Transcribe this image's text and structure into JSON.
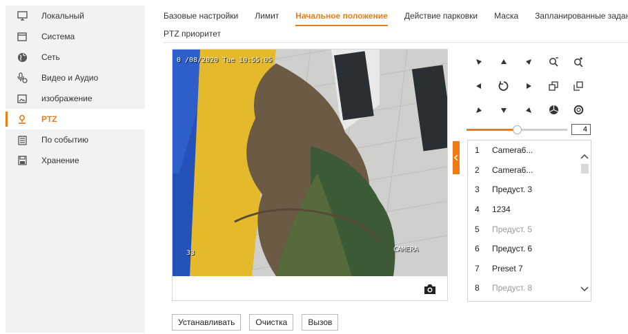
{
  "sidebar": {
    "items": [
      {
        "label": "Локальный",
        "icon": "monitor-icon"
      },
      {
        "label": "Система",
        "icon": "window-icon"
      },
      {
        "label": "Сеть",
        "icon": "globe-icon"
      },
      {
        "label": "Видео и Аудио",
        "icon": "microphone-icon"
      },
      {
        "label": "изображение",
        "icon": "image-icon"
      },
      {
        "label": "PTZ",
        "icon": "user-ptz-icon",
        "active": true
      },
      {
        "label": "По событию",
        "icon": "list-icon"
      },
      {
        "label": "Хранение",
        "icon": "storage-icon"
      }
    ]
  },
  "tabs": [
    {
      "label": "Базовые настройки"
    },
    {
      "label": "Лимит"
    },
    {
      "label": "Начальное положение",
      "active": true
    },
    {
      "label": "Действие парковки"
    },
    {
      "label": "Маска"
    },
    {
      "label": "Запланированные задания"
    },
    {
      "label": "PTZ приоритет"
    }
  ],
  "video": {
    "timestamp": "0 /08/2020 Tue 10:55:05",
    "channel_label": "33",
    "camera_label": "CAMERA"
  },
  "ptz": {
    "speed": "4",
    "speed_level": 0.5,
    "accent_color": "#f07b13"
  },
  "presets": [
    {
      "num": "1",
      "name": "Camera6...",
      "dim": false
    },
    {
      "num": "2",
      "name": "Camera6...",
      "dim": false
    },
    {
      "num": "3",
      "name": "Предуст. 3",
      "dim": false
    },
    {
      "num": "4",
      "name": "1234",
      "dim": false
    },
    {
      "num": "5",
      "name": "Предуст. 5",
      "dim": true
    },
    {
      "num": "6",
      "name": "Предуст. 6",
      "dim": false
    },
    {
      "num": "7",
      "name": "Preset 7",
      "dim": false
    },
    {
      "num": "8",
      "name": "Предуст. 8",
      "dim": true
    }
  ],
  "buttons": {
    "set": "Устанавливать",
    "clear": "Очистка",
    "call": "Вызов"
  }
}
